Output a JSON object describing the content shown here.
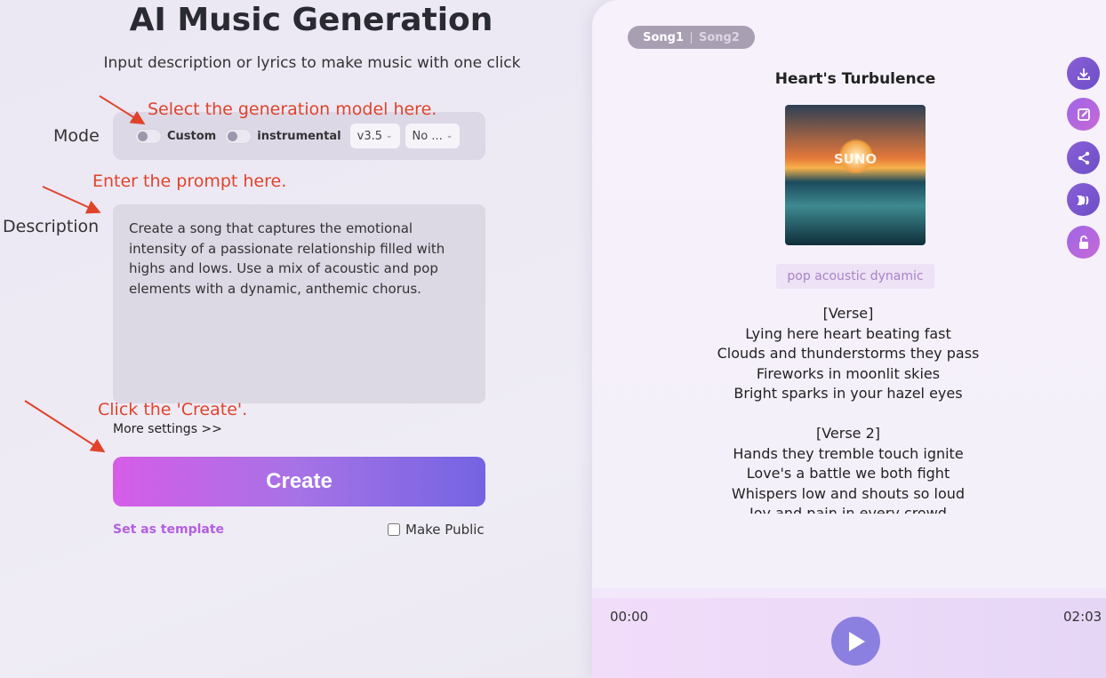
{
  "header": {
    "title": "AI Music Generation",
    "subtitle": "Input description or lyrics to make music with one click"
  },
  "form": {
    "mode_label": "Mode",
    "custom_label": "Custom",
    "instrumental_label": "instrumental",
    "custom_on": false,
    "instrumental_on": false,
    "version_value": "v3.5",
    "second_select_value": "No ...",
    "description_label": "Description",
    "description_value": "Create a song that captures the emotional intensity of a passionate relationship filled with highs and lows. Use a mix of acoustic and pop elements with a dynamic, anthemic chorus.",
    "more_settings": "More settings >>",
    "create_label": "Create",
    "set_template": "Set as template",
    "make_public": "Make Public",
    "make_public_checked": false
  },
  "annotations": {
    "mode": "Select the generation model here.",
    "prompt": "Enter the prompt here.",
    "create": "Click the 'Create'."
  },
  "player": {
    "tabs": [
      "Song1",
      "Song2"
    ],
    "active_tab": "Song1",
    "song_title": "Heart's Turbulence",
    "cover_text": "SUNO",
    "tag": "pop acoustic dynamic",
    "lyrics": [
      "[Verse]",
      "Lying here heart beating fast",
      "Clouds and thunderstorms they pass",
      "Fireworks in moonlit skies",
      "Bright sparks in your hazel eyes",
      "",
      "[Verse 2]",
      "Hands they tremble touch ignite",
      "Love's a battle we both fight",
      "Whispers low and shouts so loud",
      "Joy and pain in every crowd"
    ],
    "current_time": "00:00",
    "duration": "02:03",
    "progress": 0,
    "side_icons": [
      "download-icon",
      "edit-icon",
      "share-icon",
      "extend-icon",
      "unlock-icon"
    ]
  },
  "colors": {
    "accent": "#7464e2",
    "annotation": "#e0432b",
    "play": "#8b7fe0"
  }
}
